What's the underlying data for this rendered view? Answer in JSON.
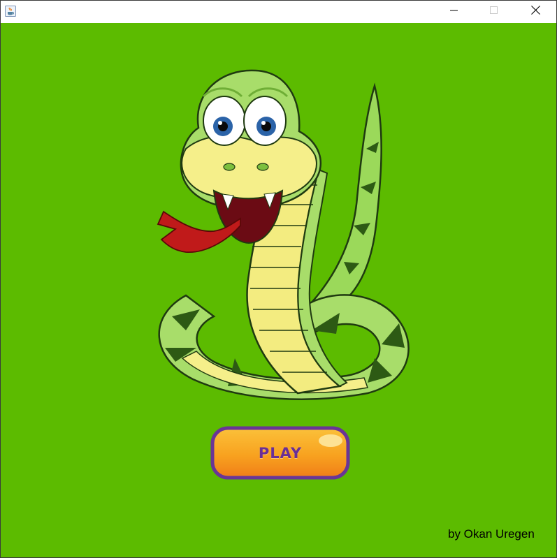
{
  "window": {
    "icon": "java-cup-icon",
    "controls": [
      "minimize-icon",
      "maximize-icon",
      "close-icon"
    ]
  },
  "game": {
    "background_color": "#5cbb00",
    "mascot": "cartoon-snake",
    "play_button": {
      "label": "PLAY",
      "fill_color": "#f8a21f",
      "border_color": "#6a3596",
      "text_color": "#6a2f96"
    },
    "credit": "by Okan Uregen"
  }
}
